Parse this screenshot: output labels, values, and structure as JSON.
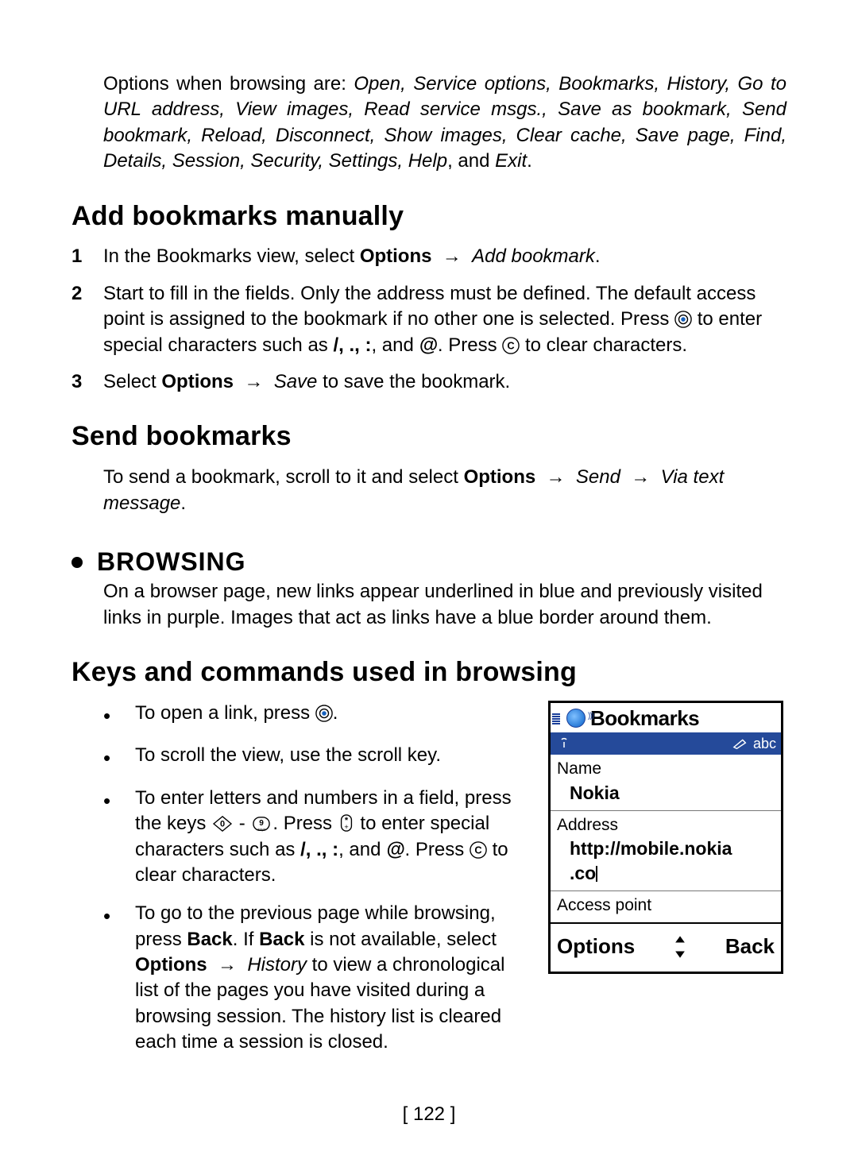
{
  "intro": {
    "lead": "Options when browsing are: ",
    "options": "Open, Service options, Bookmarks, History, Go to URL address, View images, Read service msgs., Save as bookmark, Send bookmark, Reload, Disconnect, Show images, Clear cache, Save page, Find, Details, Session, Security, Settings, Help",
    "tail": ", and ",
    "last": "Exit",
    "period": "."
  },
  "h_add": "Add bookmarks manually",
  "step1": {
    "n": "1",
    "a": "In the Bookmarks view, select ",
    "options_word": "Options",
    "gap": " → ",
    "b": "Add bookmark",
    "p": "."
  },
  "step2": {
    "n": "2",
    "a": "Start to fill in the fields. Only the address must be defined. The default access point is assigned to the bookmark if no other one is selected. Press ",
    "b": " to enter special characters such as ",
    "chars": "/, ., :",
    "c": ", and ",
    "at": "@",
    "d": ". Press ",
    "e": " to clear characters."
  },
  "step3": {
    "n": "3",
    "a": "Select ",
    "options_word": "Options",
    "save": "Save",
    "b": " to save the bookmark."
  },
  "h_send": "Send bookmarks",
  "send_para": {
    "a": "To send a bookmark, scroll to it and select ",
    "options_word": "Options",
    "send": "Send",
    "via": "Via text message",
    "p": "."
  },
  "h_browsing": "BROWSING",
  "browsing_para": "On a browser page, new links appear underlined in blue and previously visited links in purple. Images that act as links have a blue border around them.",
  "h_keys": "Keys and commands used in browsing",
  "b1": {
    "a": "To open a link, press ",
    "b": "."
  },
  "b2": "To scroll the view, use the scroll key.",
  "b3": {
    "a": "To enter letters and numbers in a field, press the keys ",
    "dash": " - ",
    "b": ". Press ",
    "c": " to enter special characters such as ",
    "chars": "/, ., :",
    "d": ", and ",
    "at": "@",
    "e": ". Press ",
    "f": " to clear characters."
  },
  "b4": {
    "a": "To go to the previous page while browsing, press ",
    "back1": "Back",
    "b": ". If ",
    "back2": "Back",
    "c": " is not available, select ",
    "options_word": "Options",
    "hist": "History",
    "d": " to view a chronological list of the pages you have visited during a browsing session. The history list is cleared each time a session is closed."
  },
  "phone": {
    "title": "Bookmarks",
    "status_abc": "abc",
    "name_label": "Name",
    "name_value": "Nokia",
    "addr_label": "Address",
    "addr_line1": "http://mobile.nokia",
    "addr_line2": ".co",
    "ap_label": "Access point",
    "sk_left": "Options",
    "sk_right": "Back"
  },
  "page_number": "[ 122 ]"
}
